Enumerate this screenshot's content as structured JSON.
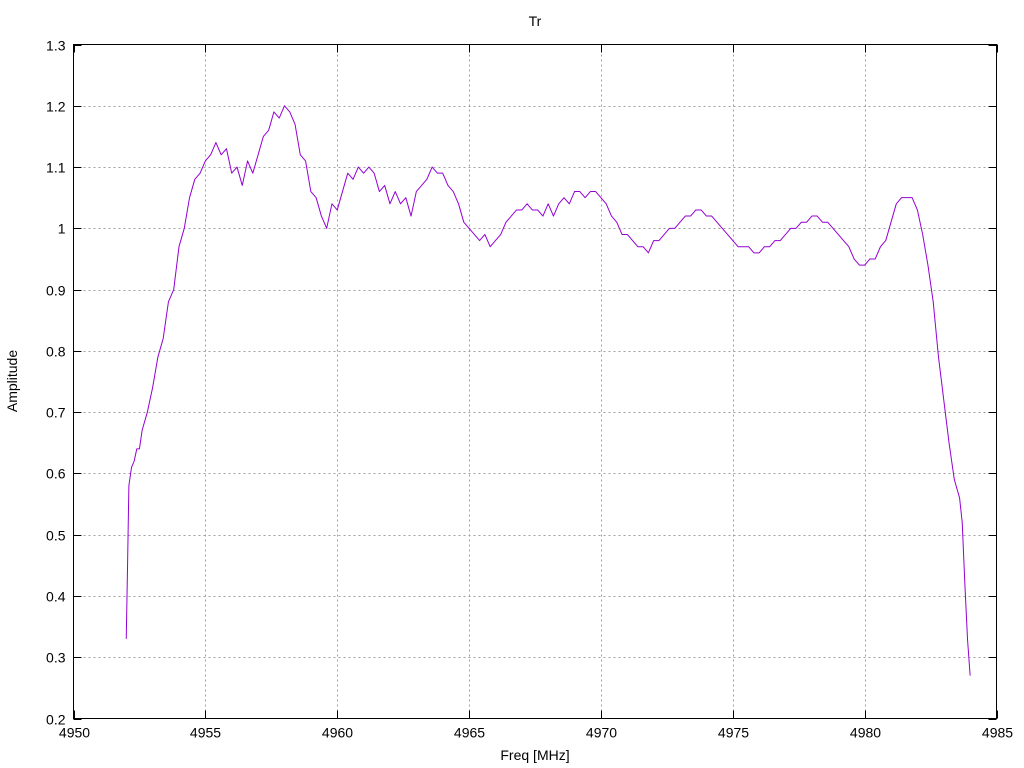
{
  "chart_data": {
    "type": "line",
    "title": "Tr",
    "xlabel": "Freq [MHz]",
    "ylabel": "Amplitude",
    "xlim": [
      4950,
      4985
    ],
    "ylim": [
      0.2,
      1.3
    ],
    "grid": true,
    "xticks": [
      4950,
      4955,
      4960,
      4965,
      4970,
      4975,
      4980,
      4985
    ],
    "yticks": [
      0.2,
      0.3,
      0.4,
      0.5,
      0.6,
      0.7,
      0.8,
      0.9,
      1,
      1.1,
      1.2,
      1.3
    ],
    "xtick_labels": [
      "4950",
      "4955",
      "4960",
      "4965",
      "4970",
      "4975",
      "4980",
      "4985"
    ],
    "ytick_labels": [
      "0.2",
      "0.3",
      "0.4",
      "0.5",
      "0.6",
      "0.7",
      "0.8",
      "0.9",
      "1",
      "1.1",
      "1.2",
      "1.3"
    ],
    "series": [
      {
        "color": "#9400d3",
        "x": [
          4952.0,
          4952.05,
          4952.1,
          4952.2,
          4952.3,
          4952.4,
          4952.5,
          4952.6,
          4952.8,
          4953.0,
          4953.2,
          4953.4,
          4953.6,
          4953.8,
          4954.0,
          4954.2,
          4954.4,
          4954.6,
          4954.8,
          4955.0,
          4955.2,
          4955.4,
          4955.6,
          4955.8,
          4956.0,
          4956.2,
          4956.4,
          4956.6,
          4956.8,
          4957.0,
          4957.2,
          4957.4,
          4957.6,
          4957.8,
          4958.0,
          4958.2,
          4958.4,
          4958.6,
          4958.8,
          4959.0,
          4959.2,
          4959.4,
          4959.6,
          4959.8,
          4960.0,
          4960.2,
          4960.4,
          4960.6,
          4960.8,
          4961.0,
          4961.2,
          4961.4,
          4961.6,
          4961.8,
          4962.0,
          4962.2,
          4962.4,
          4962.6,
          4962.8,
          4963.0,
          4963.2,
          4963.4,
          4963.6,
          4963.8,
          4964.0,
          4964.2,
          4964.4,
          4964.6,
          4964.8,
          4965.0,
          4965.2,
          4965.4,
          4965.6,
          4965.8,
          4966.0,
          4966.2,
          4966.4,
          4966.6,
          4966.8,
          4967.0,
          4967.2,
          4967.4,
          4967.6,
          4967.8,
          4968.0,
          4968.2,
          4968.4,
          4968.6,
          4968.8,
          4969.0,
          4969.2,
          4969.4,
          4969.6,
          4969.8,
          4970.0,
          4970.2,
          4970.4,
          4970.6,
          4970.8,
          4971.0,
          4971.2,
          4971.4,
          4971.6,
          4971.8,
          4972.0,
          4972.2,
          4972.4,
          4972.6,
          4972.8,
          4973.0,
          4973.2,
          4973.4,
          4973.6,
          4973.8,
          4974.0,
          4974.2,
          4974.4,
          4974.6,
          4974.8,
          4975.0,
          4975.2,
          4975.4,
          4975.6,
          4975.8,
          4976.0,
          4976.2,
          4976.4,
          4976.6,
          4976.8,
          4977.0,
          4977.2,
          4977.4,
          4977.6,
          4977.8,
          4978.0,
          4978.2,
          4978.4,
          4978.6,
          4978.8,
          4979.0,
          4979.2,
          4979.4,
          4979.6,
          4979.8,
          4980.0,
          4980.2,
          4980.4,
          4980.6,
          4980.8,
          4981.0,
          4981.2,
          4981.4,
          4981.6,
          4981.8,
          4982.0,
          4982.2,
          4982.4,
          4982.6,
          4982.8,
          4983.0,
          4983.2,
          4983.4,
          4983.6,
          4983.7,
          4983.8,
          4983.9,
          4984.0
        ],
        "y": [
          0.33,
          0.45,
          0.58,
          0.61,
          0.62,
          0.64,
          0.64,
          0.67,
          0.7,
          0.74,
          0.79,
          0.82,
          0.88,
          0.9,
          0.97,
          1.0,
          1.05,
          1.08,
          1.09,
          1.11,
          1.12,
          1.14,
          1.12,
          1.13,
          1.09,
          1.1,
          1.07,
          1.11,
          1.09,
          1.12,
          1.15,
          1.16,
          1.19,
          1.18,
          1.2,
          1.19,
          1.17,
          1.12,
          1.11,
          1.06,
          1.05,
          1.02,
          1.0,
          1.04,
          1.03,
          1.06,
          1.09,
          1.08,
          1.1,
          1.09,
          1.1,
          1.09,
          1.06,
          1.07,
          1.04,
          1.06,
          1.04,
          1.05,
          1.02,
          1.06,
          1.07,
          1.08,
          1.1,
          1.09,
          1.09,
          1.07,
          1.06,
          1.04,
          1.01,
          1.0,
          0.99,
          0.98,
          0.99,
          0.97,
          0.98,
          0.99,
          1.01,
          1.02,
          1.03,
          1.03,
          1.04,
          1.03,
          1.03,
          1.02,
          1.04,
          1.02,
          1.04,
          1.05,
          1.04,
          1.06,
          1.06,
          1.05,
          1.06,
          1.06,
          1.05,
          1.04,
          1.02,
          1.01,
          0.99,
          0.99,
          0.98,
          0.97,
          0.97,
          0.96,
          0.98,
          0.98,
          0.99,
          1.0,
          1.0,
          1.01,
          1.02,
          1.02,
          1.03,
          1.03,
          1.02,
          1.02,
          1.01,
          1.0,
          0.99,
          0.98,
          0.97,
          0.97,
          0.97,
          0.96,
          0.96,
          0.97,
          0.97,
          0.98,
          0.98,
          0.99,
          1.0,
          1.0,
          1.01,
          1.01,
          1.02,
          1.02,
          1.01,
          1.01,
          1.0,
          0.99,
          0.98,
          0.97,
          0.95,
          0.94,
          0.94,
          0.95,
          0.95,
          0.97,
          0.98,
          1.01,
          1.04,
          1.05,
          1.05,
          1.05,
          1.03,
          0.99,
          0.94,
          0.88,
          0.79,
          0.72,
          0.65,
          0.59,
          0.56,
          0.52,
          0.42,
          0.33,
          0.27
        ]
      }
    ]
  }
}
